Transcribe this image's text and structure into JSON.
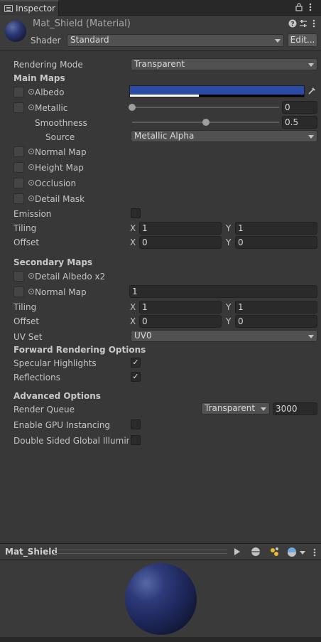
{
  "tab": {
    "label": "Inspector",
    "lock_icon": "lock-icon",
    "menu_icon": "kebab-menu-icon"
  },
  "header": {
    "title": "Mat_Shield (Material)",
    "shader_label": "Shader",
    "shader_value": "Standard",
    "edit_button": "Edit...",
    "help_icon": "help-icon",
    "preset_icon": "preset-icon",
    "menu_icon": "kebab-menu-icon"
  },
  "rendering_mode": {
    "label": "Rendering Mode",
    "value": "Transparent"
  },
  "main_maps": {
    "title": "Main Maps",
    "albedo": {
      "label": "Albedo",
      "color": "#2b4ba6"
    },
    "metallic": {
      "label": "Metallic",
      "value": "0",
      "level": 0
    },
    "smoothness": {
      "label": "Smoothness",
      "value": "0.5",
      "level": 0.5
    },
    "source": {
      "label": "Source",
      "value": "Metallic Alpha"
    },
    "normal_map": {
      "label": "Normal Map"
    },
    "height_map": {
      "label": "Height Map"
    },
    "occlusion": {
      "label": "Occlusion"
    },
    "detail_mask": {
      "label": "Detail Mask"
    },
    "emission": {
      "label": "Emission"
    },
    "tiling": {
      "label": "Tiling",
      "x_label": "X",
      "x": "1",
      "y_label": "Y",
      "y": "1"
    },
    "offset": {
      "label": "Offset",
      "x_label": "X",
      "x": "0",
      "y_label": "Y",
      "y": "0"
    }
  },
  "secondary_maps": {
    "title": "Secondary Maps",
    "detail_albedo": {
      "label": "Detail Albedo x2"
    },
    "normal_map": {
      "label": "Normal Map",
      "value": "1"
    },
    "tiling": {
      "label": "Tiling",
      "x_label": "X",
      "x": "1",
      "y_label": "Y",
      "y": "1"
    },
    "offset": {
      "label": "Offset",
      "x_label": "X",
      "x": "0",
      "y_label": "Y",
      "y": "0"
    },
    "uv_set": {
      "label": "UV Set",
      "value": "UV0"
    }
  },
  "forward": {
    "title": "Forward Rendering Options",
    "specular": {
      "label": "Specular Highlights",
      "checked": "✓"
    },
    "reflections": {
      "label": "Reflections",
      "checked": "✓"
    }
  },
  "advanced": {
    "title": "Advanced Options",
    "render_queue": {
      "label": "Render Queue",
      "mode": "Transparent",
      "value": "3000"
    },
    "gpu_instancing": {
      "label": "Enable GPU Instancing"
    },
    "double_sided": {
      "label": "Double Sided Global Illuminat"
    }
  },
  "preview": {
    "title": "Mat_Shield",
    "play_icon": "play-icon",
    "sphere_icon": "sphere-mesh-icon",
    "light_icon": "lights-icon",
    "skybox_icon": "skybox-sphere-icon",
    "menu_icon": "kebab-menu-icon"
  }
}
